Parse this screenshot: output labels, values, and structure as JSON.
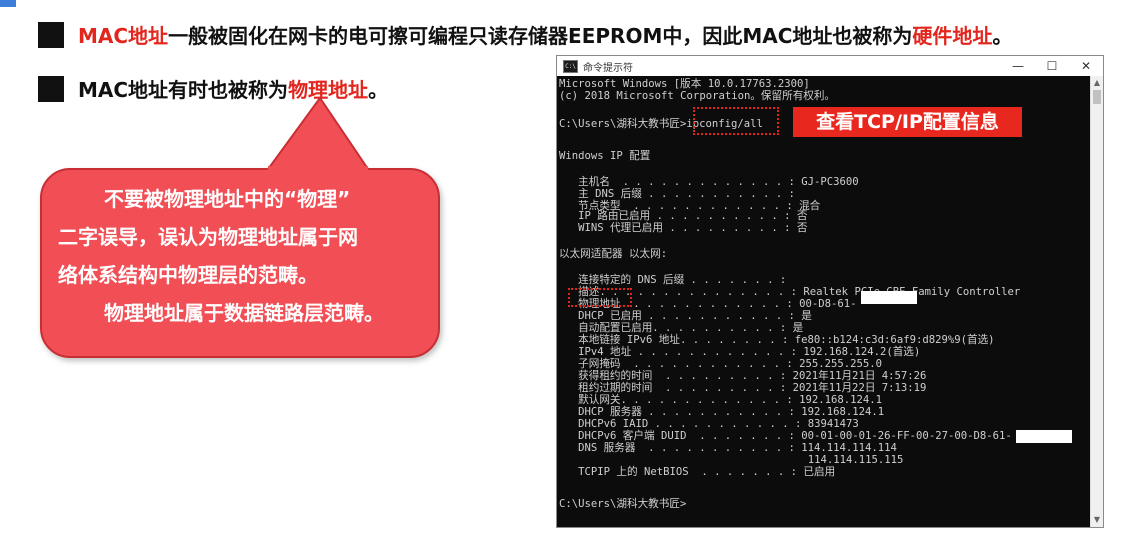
{
  "slide": {
    "bullet1": {
      "lead": "MAC地址",
      "middle": "一般被固化在网卡的电可擦可编程只读存储器EEPROM中，因此MAC地址也被称为",
      "highlight": "硬件地址",
      "end": "。"
    },
    "bullet2": {
      "lead": "MAC地址有时也被称为",
      "highlight": "物理地址",
      "end": "。"
    },
    "callout": {
      "line1": "不要被物理地址中的“物理”",
      "line2": "二字误导，误认为物理地址属于网",
      "line3": "络体系结构中物理层的范畴。",
      "line4": "物理地址属于数据链路层范畴。"
    },
    "tag": "查看TCP/IP配置信息",
    "colors": {
      "accent_red": "#e2261e",
      "callout_fill": "#f24e55",
      "tag_fill": "#e8281f",
      "console_bg": "#0c0c0c"
    }
  },
  "window": {
    "title": "命令提示符",
    "title_icon": "C:\\",
    "minimize": "—",
    "maximize": "☐",
    "close": "✕",
    "icons": {
      "app": "cmd-icon",
      "scroll_up": "arrow-up-icon",
      "scroll_down": "arrow-down-icon"
    }
  },
  "console": {
    "lines": [
      "Microsoft Windows [版本 10.0.17763.2300]",
      "(c) 2018 Microsoft Corporation。保留所有权利。",
      "",
      "C:\\Users\\湖科大教书匠>ipconfig/all",
      "",
      "Windows IP 配置",
      "",
      "   主机名  . . . . . . . . . . . . . : GJ-PC3600",
      "   主 DNS 后缀 . . . . . . . . . . . :",
      "   节点类型  . . . . . . . . . . . . : 混合",
      "   IP 路由已启用 . . . . . . . . . . : 否",
      "   WINS 代理已启用 . . . . . . . . . : 否",
      "",
      "以太网适配器 以太网:",
      "",
      "   连接特定的 DNS 后缀 . . . . . . . :",
      "   描述. . . . . . . . . . . . . . . : Realtek PCIe GBE Family Controller",
      "   物理地址. . . . . . . . . . . . . : 00-D8-61-",
      "   DHCP 已启用 . . . . . . . . . . . : 是",
      "   自动配置已启用. . . . . . . . . . : 是",
      "   本地链接 IPv6 地址. . . . . . . . : fe80::b124:c3d:6af9:d829%9(首选)",
      "   IPv4 地址 . . . . . . . . . . . . : 192.168.124.2(首选)",
      "   子网掩码  . . . . . . . . . . . . : 255.255.255.0",
      "   获得租约的时间  . . . . . . . . . : 2021年11月21日 4:57:26",
      "   租约过期的时间  . . . . . . . . . : 2021年11月22日 7:13:19",
      "   默认网关. . . . . . . . . . . . . : 192.168.124.1",
      "   DHCP 服务器 . . . . . . . . . . . : 192.168.124.1",
      "   DHCPv6 IAID . . . . . . . . . . . : 83941473",
      "   DHCPv6 客户端 DUID  . . . . . . . : 00-01-00-01-26-FF-00-27-00-D8-61-",
      "   DNS 服务器  . . . . . . . . . . . : 114.114.114.114",
      "                                       114.114.115.115",
      "   TCPIP 上的 NetBIOS  . . . . . . . : 已启用",
      "",
      "C:\\Users\\湖科大教书匠>"
    ]
  }
}
